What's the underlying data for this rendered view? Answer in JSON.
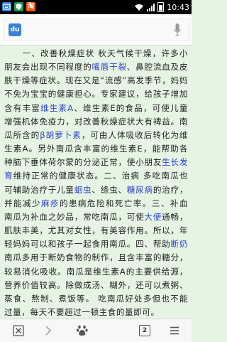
{
  "status_bar": {
    "time": "10:43",
    "app_icons": [
      "tencent-news-icon",
      "shield-icon",
      "taobao-icon"
    ],
    "taobao_glyph": "淘"
  },
  "search": {
    "logo_text": "du",
    "placeholder": ""
  },
  "article": {
    "segments": [
      {
        "t": "一、改善秋燥症状 秋天气候干燥，许多小朋友会出现不同程度的"
      },
      {
        "t": "嘴唇干裂",
        "k": true
      },
      {
        "t": "、鼻腔流血及皮肤干燥等症状。现在又是“流感”高发季节，妈妈不免为宝宝的健康担心。专家建议，给孩子增加含有丰富"
      },
      {
        "t": "维生素A",
        "k": true
      },
      {
        "t": "、维生素E的食品，可使儿童增强机体免疫力，对改善秋燥症状大有裨益。南瓜所含的"
      },
      {
        "t": "β胡萝卜素",
        "k": true
      },
      {
        "t": "，可由人体吸收后转化为维生素A。另外南瓜含丰富的维生素E，能帮助各种脑下垂体荷尔蒙的分泌正常，使小朋友"
      },
      {
        "t": "生长发育",
        "k": true
      },
      {
        "t": "维持正常的健康状态。二、治病 多吃南瓜也可辅助治疗于儿童"
      },
      {
        "t": "蛔虫",
        "k": true
      },
      {
        "t": "、绦虫、"
      },
      {
        "t": "糖尿病",
        "k": true
      },
      {
        "t": "的治疗，并能减少"
      },
      {
        "t": "麻疹",
        "k": true
      },
      {
        "t": "的患病危险和死亡率。三、补血 南瓜为补血之妙品，常吃南瓜，可使"
      },
      {
        "t": "大便",
        "k": true
      },
      {
        "t": "通畅，肌肤丰美，尤其对女性，有美容作用。所以，年轻妈妈可以和孩子一起食用南瓜。四、帮助"
      },
      {
        "t": "断奶",
        "k": true
      },
      {
        "t": " 南瓜多用于断奶食物的制作，且含丰富的糖分，较易消化吸收。南瓜是维生素A的主要供给源，营养价值较高。除做成汤、糊外，还可以煮粥、蒸食、熬制、煮饭等。 吃南瓜好处多但也不能过量，每天不要超过一顿主食的量即可。"
      }
    ]
  },
  "bottom_nav": {
    "tabs_count": "2"
  }
}
